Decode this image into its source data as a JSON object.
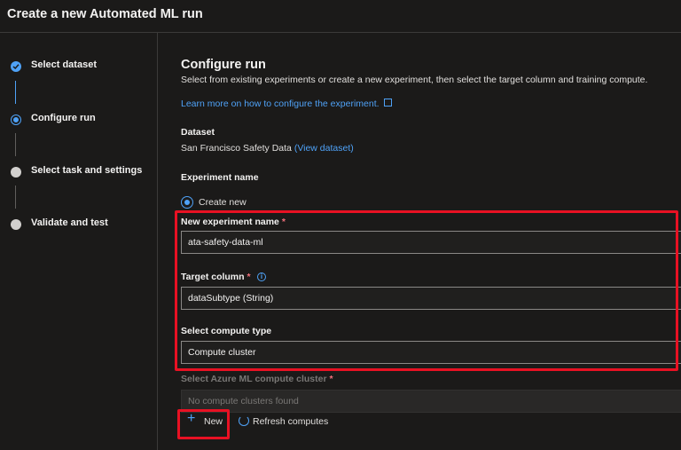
{
  "header": {
    "title": "Create a new Automated ML run"
  },
  "steps": [
    {
      "label": "Select dataset",
      "state": "done"
    },
    {
      "label": "Configure run",
      "state": "current"
    },
    {
      "label": "Select task and settings",
      "state": "pending"
    },
    {
      "label": "Validate and test",
      "state": "pending"
    }
  ],
  "main": {
    "title": "Configure run",
    "description": "Select from existing experiments or create a new experiment, then select the target column and training compute.",
    "learn_more": "Learn more on how to configure the experiment.",
    "dataset_label": "Dataset",
    "dataset_name": "San Francisco Safety Data",
    "view_dataset": "(View dataset)",
    "experiment_label": "Experiment name",
    "radio_create_new": "Create new",
    "new_experiment_label": "New experiment name",
    "new_experiment_value": "ata-safety-data-ml",
    "target_column_label": "Target column",
    "target_column_value": "dataSubtype (String)",
    "compute_type_label": "Select compute type",
    "compute_type_value": "Compute cluster",
    "compute_cluster_label": "Select Azure ML compute cluster",
    "compute_cluster_placeholder": "No compute clusters found",
    "required_mark": "*",
    "new_button": "New",
    "refresh_button": "Refresh computes"
  },
  "colors": {
    "accent": "#4fa2f7",
    "highlight": "#e81123",
    "required": "#f1707b",
    "background": "#1b1a19"
  }
}
